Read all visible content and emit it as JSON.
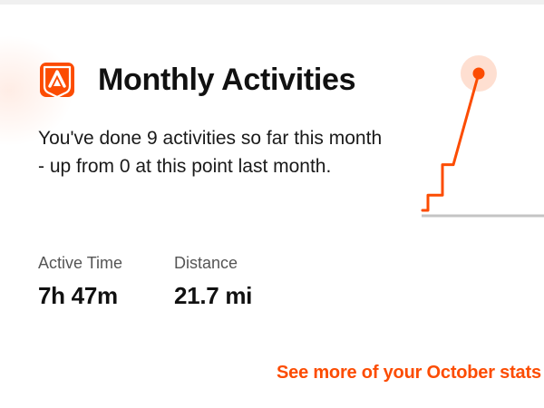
{
  "card": {
    "title": "Monthly Activities",
    "description": "You've done 9 activities so far this month - up from 0 at this point last month.",
    "accent_color": "#fc4c02",
    "logo_icon": "strava-logo-icon"
  },
  "stats": {
    "active_time": {
      "label": "Active Time",
      "value": "7h 47m"
    },
    "distance": {
      "label": "Distance",
      "value": "21.7 mi"
    }
  },
  "chart_data": {
    "type": "line",
    "title": "",
    "xlabel": "",
    "ylabel": "",
    "grid": false,
    "series": [
      {
        "color": "#fc4c02",
        "values": [
          0,
          1,
          1,
          3,
          3,
          9
        ]
      }
    ],
    "ylim": [
      0,
      9
    ]
  },
  "footer": {
    "see_more_label": "See more of your October stats"
  }
}
